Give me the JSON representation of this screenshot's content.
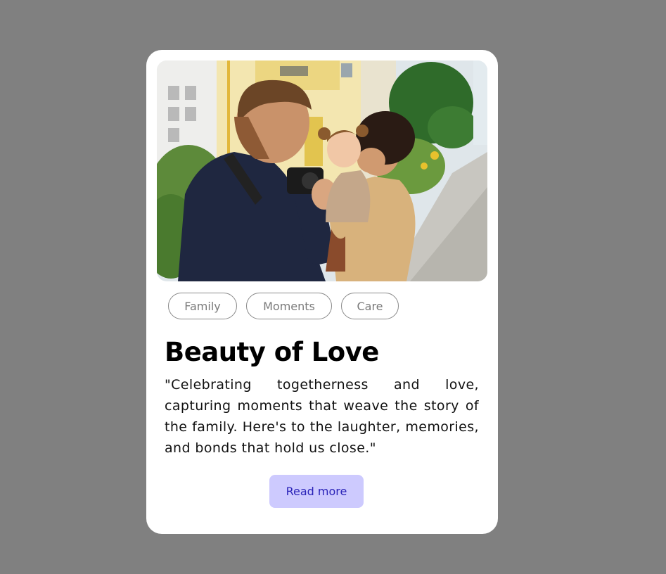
{
  "card": {
    "image": {
      "alt": "family photo"
    },
    "tags": [
      {
        "label": "Family"
      },
      {
        "label": "Moments"
      },
      {
        "label": "Care"
      }
    ],
    "title": "Beauty of Love",
    "description": "\"Celebrating togetherness and love, capturing moments that weave the story of the family. Here's to the laughter, memories, and bonds that hold us close.\"",
    "button_label": "Read more"
  },
  "colors": {
    "page_background": "#808080",
    "card_background": "#ffffff",
    "button_background": "#cdcafe",
    "button_text": "#2a23b8",
    "tag_border": "#8a8a8a"
  }
}
